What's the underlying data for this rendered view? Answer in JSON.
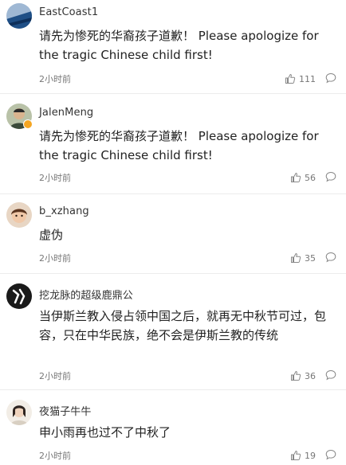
{
  "comments": [
    {
      "username": "EastCoast1",
      "content": "请先为惨死的华裔孩子道歉！ Please apologize for the tragic Chinese child first!",
      "time": "2小时前",
      "likes": "111",
      "avatar_color": "#1f4f86",
      "verified": false
    },
    {
      "username": "JalenMeng",
      "content": "请先为惨死的华裔孩子道歉！ Please apologize for the tragic Chinese child first!",
      "time": "2小时前",
      "likes": "56",
      "avatar_color": "#7d8a6a",
      "verified": true
    },
    {
      "username": "b_xzhang",
      "content": "虚伪",
      "time": "2小时前",
      "likes": "35",
      "avatar_color": "#b07a55",
      "verified": false
    },
    {
      "username": "挖龙脉的超级鹿鼎公",
      "content": "当伊斯兰教入侵占领中国之后，就再无中秋节可过，包容，只在中华民族，绝不会是伊斯兰教的传统",
      "time": "2小时前",
      "likes": "36",
      "avatar_color": "#1a1a1a",
      "verified": false
    },
    {
      "username": "夜猫子牛牛",
      "content": "申小雨再也过不了中秋了",
      "time": "2小时前",
      "likes": "19",
      "avatar_color": "#e6ddd0",
      "verified": false
    }
  ],
  "icons": {
    "like": "thumbs-up-icon",
    "reply": "comment-bubble-icon"
  },
  "colors": {
    "text": "#333333",
    "meta": "#777777",
    "divider": "#ececec",
    "verified": "#f5a623"
  }
}
